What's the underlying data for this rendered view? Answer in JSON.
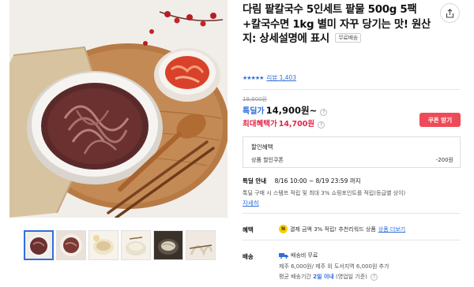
{
  "product": {
    "title": "다림 팥칼국수 5인세트 팥물 500g 5팩+칼국수면 1kg 별미 자꾸 당기는 맛! 원산지: 상세설명에 표시",
    "free_shipping_tag": "무료배송"
  },
  "rating": {
    "stars": 5,
    "review_text": "리뷰 1,403"
  },
  "price": {
    "original": "19,900원",
    "deal_label": "톡딜가",
    "deal_price": "14,900원~",
    "max_label": "최대혜택가",
    "max_price": "14,700원",
    "coupon_button": "쿠폰 받기"
  },
  "discount": {
    "header": "할인혜택",
    "coupon_name": "상품 할인쿠폰",
    "coupon_amount": "-200원"
  },
  "deal_notice": {
    "label": "톡딜 안내",
    "period": "8/16 10:00 ~ 8/19 23:59 까지",
    "stamp_text": "톡딜 구매 시 스탬프 적립 및 최대 3% 쇼핑포인트를 적립(등급별 상이)",
    "detail_link": "자세히"
  },
  "benefit": {
    "label": "혜택",
    "pay_icon_text": "pay",
    "text": "결제 금액 3% 적립! 추천리워드 상품",
    "more_link": "상품 더보기"
  },
  "shipping": {
    "label": "배송",
    "free_text": "배송비 무료",
    "extra_text": "제주 6,000원/ 제주 외 도서지역 6,000원 추가",
    "period_prefix": "평균 배송기간",
    "period_value": "2일 이내",
    "period_suffix": "(영업일 기준)"
  },
  "colors": {
    "accent_blue": "#2f6fdb",
    "accent_red": "#e0264a",
    "coupon_button": "#ee4b58"
  },
  "icons": [
    "share-icon",
    "star-icon",
    "question-icon",
    "pay-icon",
    "truck-icon"
  ]
}
